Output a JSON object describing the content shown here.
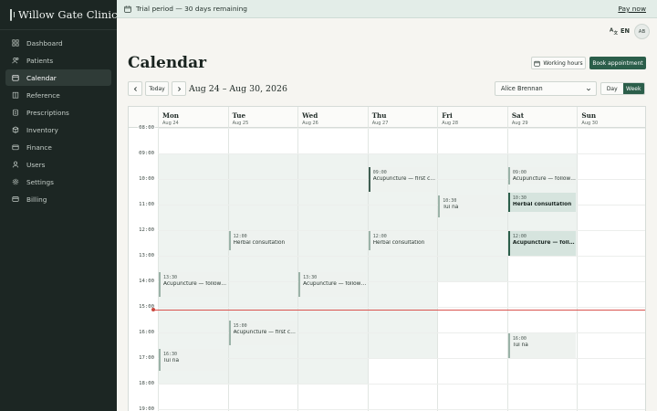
{
  "brand": {
    "name": "Willow Gate Clinic"
  },
  "nav": {
    "items": [
      {
        "label": "Dashboard",
        "icon": "grid-icon",
        "active": false
      },
      {
        "label": "Patients",
        "icon": "users-icon",
        "active": false
      },
      {
        "label": "Calendar",
        "icon": "calendar-icon",
        "active": true
      },
      {
        "label": "Reference",
        "icon": "book-icon",
        "active": false
      },
      {
        "label": "Prescriptions",
        "icon": "clipboard-icon",
        "active": false
      },
      {
        "label": "Inventory",
        "icon": "box-icon",
        "active": false
      },
      {
        "label": "Finance",
        "icon": "wallet-icon",
        "active": false
      },
      {
        "label": "Users",
        "icon": "user-icon",
        "active": false
      },
      {
        "label": "Settings",
        "icon": "gear-icon",
        "active": false
      },
      {
        "label": "Billing",
        "icon": "card-icon",
        "active": false
      }
    ]
  },
  "banner": {
    "text": "Trial period — 30 days remaining",
    "action": "Pay now"
  },
  "topbar": {
    "language": "EN",
    "avatar_initials": "AB"
  },
  "page": {
    "title": "Calendar",
    "working_hours_label": "Working hours",
    "book_label": "Book appointment",
    "today_label": "Today",
    "date_range": "Aug 24 – Aug 30, 2026",
    "practitioner": "Alice Brennan",
    "view_day": "Day",
    "view_week": "Week"
  },
  "colors": {
    "sidebar": "#1c2623",
    "accent": "#2b5e4a",
    "banner": "#e3ede8",
    "now_line": "#d9534f"
  },
  "calendar": {
    "days": [
      {
        "name": "Mon",
        "date": "Aug 24"
      },
      {
        "name": "Tue",
        "date": "Aug 25"
      },
      {
        "name": "Wed",
        "date": "Aug 26"
      },
      {
        "name": "Thu",
        "date": "Aug 27"
      },
      {
        "name": "Fri",
        "date": "Aug 28"
      },
      {
        "name": "Sat",
        "date": "Aug 29"
      },
      {
        "name": "Sun",
        "date": "Aug 30"
      }
    ],
    "hours": [
      "08:00",
      "09:00",
      "10:00",
      "11:00",
      "12:00",
      "13:00",
      "14:00",
      "15:00",
      "16:00",
      "17:00",
      "18:00",
      "19:00"
    ],
    "working_hours": [
      {
        "day": 0,
        "start": 9,
        "end": 18
      },
      {
        "day": 1,
        "start": 9,
        "end": 18
      },
      {
        "day": 2,
        "start": 9,
        "end": 18
      },
      {
        "day": 3,
        "start": 9,
        "end": 17
      },
      {
        "day": 4,
        "start": 9,
        "end": 14
      },
      {
        "day": 5,
        "start": 9,
        "end": 13
      }
    ],
    "now_time": 15.1,
    "events": [
      {
        "day": 3,
        "start": 9.5,
        "end": 10.5,
        "time": "09:00",
        "title": "Acupuncture — first con…",
        "style": "dark"
      },
      {
        "day": 5,
        "start": 9.5,
        "end": 10.2,
        "time": "09:00",
        "title": "Acupuncture — follow-up",
        "style": "normal"
      },
      {
        "day": 4,
        "start": 10.6,
        "end": 11.5,
        "time": "10:30",
        "title": "Tui na",
        "style": "normal"
      },
      {
        "day": 5,
        "start": 10.5,
        "end": 11.3,
        "time": "10:30",
        "title": "Herbal consultation",
        "style": "strong"
      },
      {
        "day": 1,
        "start": 12.0,
        "end": 12.8,
        "time": "12:00",
        "title": "Herbal consultation",
        "style": "normal"
      },
      {
        "day": 3,
        "start": 12.0,
        "end": 12.8,
        "time": "12:00",
        "title": "Herbal consultation",
        "style": "normal"
      },
      {
        "day": 5,
        "start": 12.0,
        "end": 13.0,
        "time": "12:00",
        "title": "Acupuncture — follow-up",
        "style": "strong"
      },
      {
        "day": 0,
        "start": 13.6,
        "end": 14.6,
        "time": "13:30",
        "title": "Acupuncture — follow-up",
        "style": "normal"
      },
      {
        "day": 2,
        "start": 13.6,
        "end": 14.6,
        "time": "13:30",
        "title": "Acupuncture — follow-up",
        "style": "normal"
      },
      {
        "day": 1,
        "start": 15.5,
        "end": 16.5,
        "time": "15:00",
        "title": "Acupuncture — first con…",
        "style": "normal"
      },
      {
        "day": 0,
        "start": 16.6,
        "end": 17.5,
        "time": "16:30",
        "title": "Tui na",
        "style": "normal"
      },
      {
        "day": 5,
        "start": 16.0,
        "end": 17.0,
        "time": "16:00",
        "title": "Tui na",
        "style": "normal"
      }
    ]
  }
}
